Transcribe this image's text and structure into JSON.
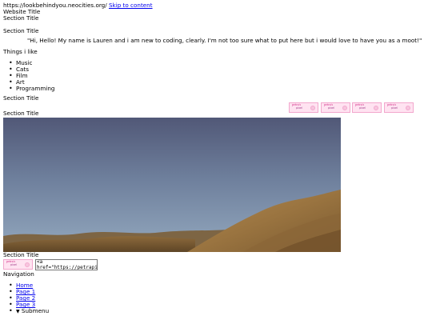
{
  "header": {
    "url": "https://lookbehindyou.neocities.org/",
    "skip_link": "Skip to content",
    "website_title": "Website Title",
    "section_title_1": "Section Title"
  },
  "intro": {
    "section_title": "Section Title",
    "quote": "\"Hi, Hello! My name is Lauren and i am new to coding, clearly. I'm not too sure what to put here but i would love to have you as a moot!\""
  },
  "likes": {
    "heading": "Things i like",
    "items": [
      "Music",
      "Cats",
      "Film",
      "Art",
      "Programming"
    ]
  },
  "buttons_section": {
    "section_title": "Section Title",
    "button_line1": "petra's",
    "button_line2": "pixel"
  },
  "image_section": {
    "section_title": "Section Title"
  },
  "embed_section": {
    "section_title": "Section Title",
    "code_value": "<a href=\"https://petrapi"
  },
  "navigation": {
    "heading": "Navigation",
    "items": [
      "Home",
      "Page 1",
      "Page 2",
      "Page 3"
    ],
    "submenu": "Submenu",
    "submenu_marker": "▼"
  },
  "colors": {
    "link": "#0000ee",
    "button_bg": "#ffe3f1",
    "button_border": "#f2a7cd"
  }
}
